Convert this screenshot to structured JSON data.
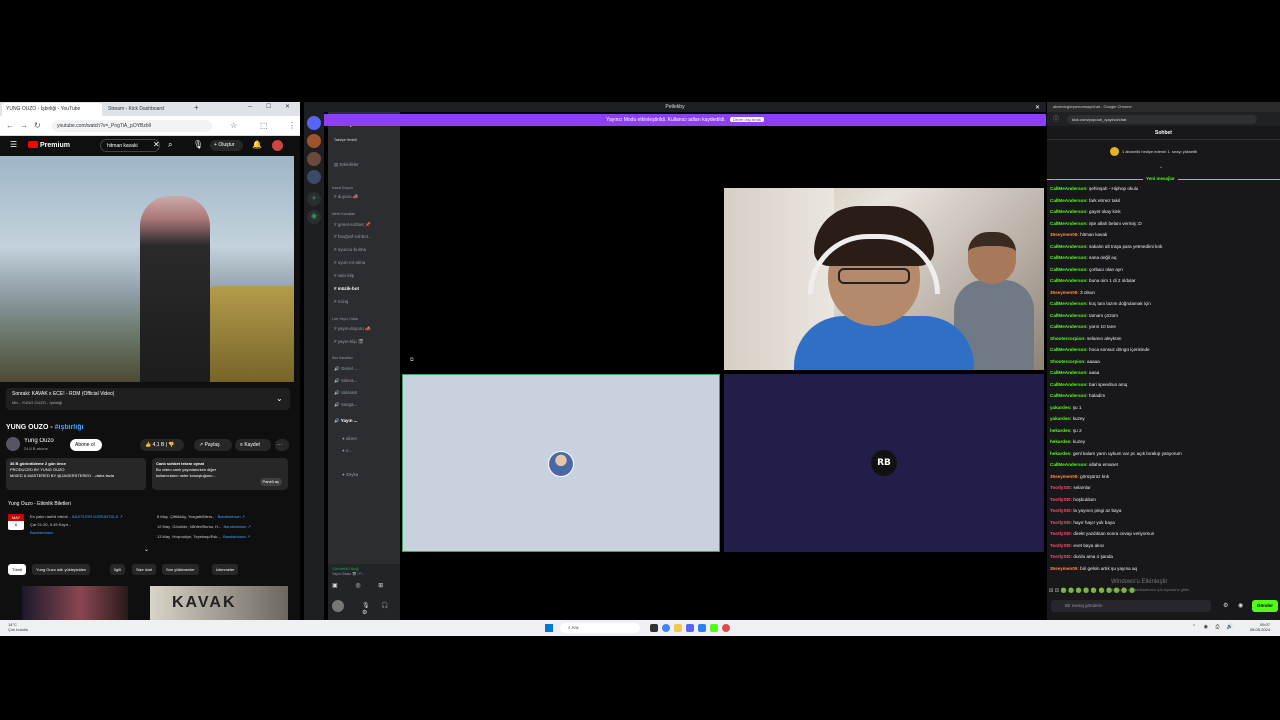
{
  "youtube": {
    "tab_active": "YUNG OUZO - İşbirliği - YouTube",
    "tab_second": "Stream - Kick Dashboard",
    "url": "youtube.com/watch?v=_PngTiA_pOYBzbll",
    "logo": "Premium",
    "search_value": "hitman kavaki",
    "create_label": "Oluştur",
    "up_next_title": "Sonraki: KAVAK x ECE! - RDM (Official Video)",
    "up_next_sub": "Mix - YUNG OUZO - İşbirliği",
    "video_title_main": "YUNG OUZO - ",
    "video_title_tag": "#işbirliği",
    "channel_name": "Yung Ouzo",
    "channel_subs": "24,5 B abone",
    "subscribe_label": "Abone ol",
    "like_count": "4,1 B",
    "share_label": "Paylaş",
    "save_label": "Kaydet",
    "more_label": "···",
    "desc_line1": "36 B görüntüleme  2 gün önce",
    "desc_line2": "PRODUCED BY YUNG OUZO",
    "desc_line3": "MIXED & MASTERED BY @JAGERSTEREO  ...daha fazla",
    "chat_card_title": "Canlı sohbet tekrar oynat",
    "chat_card_line1": "Bu video canlı yayınlanırken diğer",
    "chat_card_line2": "kullanıcıların neler konuştuğunu...",
    "chat_card_btn": "Paneli aç",
    "events_heading": "Yung Ouzo - Etkinlik Biletleri",
    "event_date_month": "MAY",
    "event_date_day": "6",
    "event_first_label": "En yakın tarihli etkinli...",
    "event_first_link": "BİLETLERİ GÖRÜNTÜLE ↗",
    "event_first_time": "Çar 21:30, 5.45 Kayıt...",
    "event_first_vendor": "Bandsintown",
    "events": [
      {
        "date": "8 May",
        "place": "Çiftlikköy, Yozgatlı/Mers...",
        "vendor": "Bandsintown ↗"
      },
      {
        "date": "12 May",
        "place": "Gönülde, Nilüfer/Bursa, H...",
        "vendor": "Bandsintown ↗"
      },
      {
        "date": "13 May",
        "place": "Hoşnudiye, Tepebaşı/Esk...",
        "vendor": "Bandsintown ↗"
      }
    ],
    "chips": [
      "Tümü",
      "Yung Ouzo adlı yükleyiciden",
      "İlgili",
      "Size özel",
      "Son yüklenenler",
      "İzlenmeler"
    ],
    "thumb2_text": "KAVAK"
  },
  "discord": {
    "window_title": "Petlekby",
    "server_name": "Petlekby",
    "top_items": [
      "Takviye Hedefi",
      "Etkinlikler"
    ],
    "categories": {
      "kanal": "Kanal Duyuru",
      "metin": "Metin Kanalları",
      "live": "Live Yayın Odası",
      "ses": "Ses Kanalları"
    },
    "announce_channels": [
      "duyuru 📣"
    ],
    "text_channels": [
      "genel-sohbet 📌",
      "fotoğraf-sohbet...",
      "oyuncu-bulma",
      "oyun-rol-alma",
      "valo-klip",
      "müzik-bot",
      "mizaj"
    ],
    "live_channels": [
      "yayın-duyuru 📣",
      "yayın-klip 🎬"
    ],
    "voice_channels": [
      "Genel ...",
      "Valora...",
      "Valorant",
      "Vanga...",
      "Yayın ..."
    ],
    "voice_members": [
      "akıen",
      "e...",
      "Zeyka"
    ],
    "voice_status": "Görüntülü Bağl",
    "voice_sub": "Yayın Odası 🎬 / P...",
    "banner_text": "Yayıncı Modu etkinleştirildi. Kullanıcı adları kaydedildi.",
    "banner_button": "Devre dışı bırak",
    "tile_b_label": "RB"
  },
  "kick": {
    "tab_title": "akdenizg/mperurnsay/chat - Google Chrome",
    "url": "kick.com/popout/_/yayinci/chat",
    "header": "Sohbet",
    "gift_text": "1 abonelik hediye edenin 1. sırayı yükseltti",
    "new_messages": "Yeni mesajlar",
    "messages": [
      {
        "user": "CallMeAnderson:",
        "text": " şehinşah - Hiphop okulu",
        "color": "#53fc18"
      },
      {
        "user": "CallMeAnderson:",
        "text": " fark etmez takıl",
        "color": "#53fc18"
      },
      {
        "user": "CallMeAnderson:",
        "text": " gayet okay kink",
        "color": "#53fc18"
      },
      {
        "user": "CallMeAnderson:",
        "text": " işte allah belanı vermiş :D",
        "color": "#53fc18"
      },
      {
        "user": "35seymen05:",
        "text": " hitman kavak",
        "color": "#ff8a3d"
      },
      {
        "user": "CallMeAnderson:",
        "text": " sakalın alt traşa para yetmedimi knk",
        "color": "#53fc18"
      },
      {
        "user": "CallMeAnderson:",
        "text": " sana değil aq",
        "color": "#53fc18"
      },
      {
        "user": "CallMeAnderson:",
        "text": " çorbacı olan ayrı",
        "color": "#53fc18"
      },
      {
        "user": "CallMeAnderson:",
        "text": " buna oim 1 di 2 oldular",
        "color": "#53fc18"
      },
      {
        "user": "35seymen05:",
        "text": " 3 olsun",
        "color": "#ff8a3d"
      },
      {
        "user": "CallMeAnderson:",
        "text": " koç tanı lazım doğrulamak için",
        "color": "#53fc18"
      },
      {
        "user": "CallMeAnderson:",
        "text": " tamam çözüm",
        "color": "#53fc18"
      },
      {
        "user": "CallMeAnderson:",
        "text": " yarın 10 tane",
        "color": "#53fc18"
      },
      {
        "user": "Shootercorpion:",
        "text": " selamın aleyküm",
        "color": "#53fc18"
      },
      {
        "user": "CallMeAnderson:",
        "text": " hoca sonsuz döngü içerisinde",
        "color": "#53fc18"
      },
      {
        "user": "Shootercorpion:",
        "text": " aaaaa",
        "color": "#53fc18"
      },
      {
        "user": "CallMeAnderson:",
        "text": " aaaa",
        "color": "#53fc18"
      },
      {
        "user": "CallMeAnderson:",
        "text": " bari speedrun amq",
        "color": "#53fc18"
      },
      {
        "user": "CallMeAnderson:",
        "text": " haladim",
        "color": "#53fc18"
      },
      {
        "user": "yakardes:",
        "text": " şu 1",
        "color": "#53fc18"
      },
      {
        "user": "yakardes:",
        "text": " kuzey",
        "color": "#53fc18"
      },
      {
        "user": "hekardes:",
        "text": " şu 2",
        "color": "#53fc18"
      },
      {
        "user": "hekardes:",
        "text": " kuzey",
        "color": "#53fc18"
      },
      {
        "user": "hekardes:",
        "text": " genl kalam yarın uykum var pc açık bırakıp yatıyorum",
        "color": "#53fc18"
      },
      {
        "user": "CallMeAnderson:",
        "text": " allaha emanet",
        "color": "#53fc18"
      },
      {
        "user": "35seymen05:",
        "text": " görüşürüz knk",
        "color": "#ff8a3d"
      },
      {
        "user": "TootlySt0:",
        "text": " selamlar",
        "color": "#ff4d6d"
      },
      {
        "user": "TootlySt0:",
        "text": " hoşbuldum",
        "color": "#ff4d6d"
      },
      {
        "user": "TootlySt0:",
        "text": " la yayının pingi az baya",
        "color": "#ff4d6d"
      },
      {
        "user": "TootlySt0:",
        "text": " hayır hayır yok baya",
        "color": "#ff4d6d"
      },
      {
        "user": "TootlySt0:",
        "text": " direkt yazdıktan sonra cevap veriyorsun",
        "color": "#ff4d6d"
      },
      {
        "user": "TootlySt0:",
        "text": " evet baya akıcı",
        "color": "#ff4d6d"
      },
      {
        "user": "TootlySt0:",
        "text": " durdu ama o şanda",
        "color": "#ff4d6d"
      },
      {
        "user": "35seymen05:",
        "text": " biri gelsin artık şu yayına aq",
        "color": "#ff8a3d"
      }
    ],
    "watermark_title": "Windows'u Etkinleştir",
    "watermark_sub": "Windows'u etkinleştirmek için Ayarlar'a gidin.",
    "input_placeholder": "Bir mesaj gönderin",
    "send_label": "Gönder"
  },
  "taskbar": {
    "weather_line1": "14°C",
    "weather_line2": "Çok bulutlu",
    "search_placeholder": "Ara",
    "time": "09:07",
    "date": "08.05.2024"
  }
}
